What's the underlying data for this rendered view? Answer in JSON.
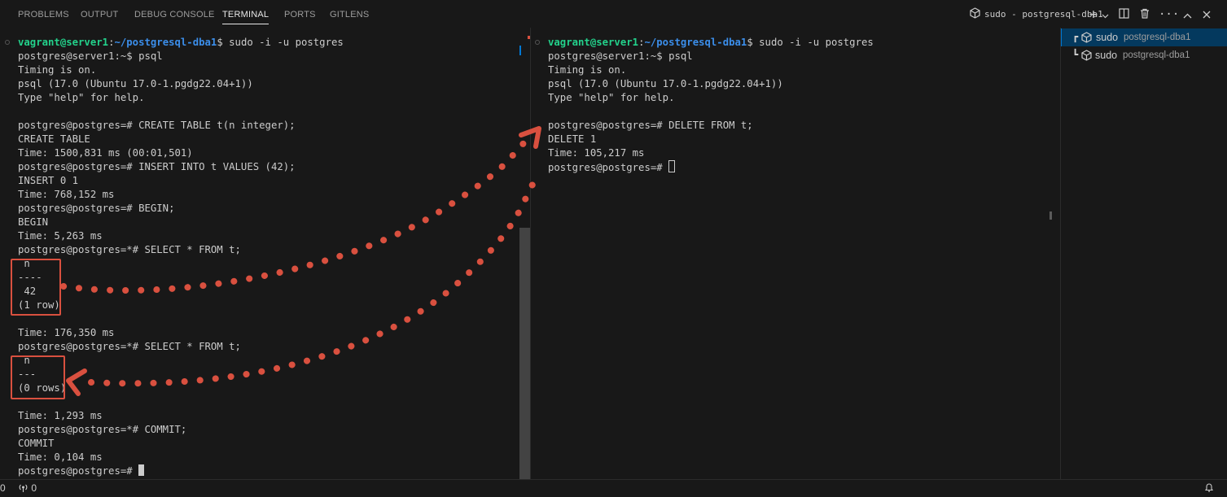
{
  "panel": {
    "tabs": [
      {
        "label": "PROBLEMS",
        "active": false
      },
      {
        "label": "OUTPUT",
        "active": false
      },
      {
        "label": "DEBUG CONSOLE",
        "active": false
      },
      {
        "label": "TERMINAL",
        "active": true
      },
      {
        "label": "PORTS",
        "active": false
      },
      {
        "label": "GITLENS",
        "active": false
      }
    ],
    "active_terminal_title": "sudo - postgresql-dba1",
    "toolbar_icons": [
      "terminal-icon",
      "add-icon",
      "chevron-down-icon",
      "split-icon",
      "trash-icon",
      "more-icon",
      "chevron-up-icon",
      "close-icon"
    ]
  },
  "left_terminal": {
    "prompt": {
      "user": "vagrant@server1",
      "path": "~/postgresql-dba1",
      "command": "$ sudo -i -u postgres"
    },
    "lines": [
      "postgres@server1:~$ psql",
      "Timing is on.",
      "psql (17.0 (Ubuntu 17.0-1.pgdg22.04+1))",
      "Type \"help\" for help.",
      "",
      "postgres@postgres=# CREATE TABLE t(n integer);",
      "CREATE TABLE",
      "Time: 1500,831 ms (00:01,501)",
      "postgres@postgres=# INSERT INTO t VALUES (42);",
      "INSERT 0 1",
      "Time: 768,152 ms",
      "postgres@postgres=# BEGIN;",
      "BEGIN",
      "Time: 5,263 ms",
      "postgres@postgres=*# SELECT * FROM t;",
      " n",
      "----",
      " 42",
      "(1 row)",
      "",
      "Time: 176,350 ms",
      "postgres@postgres=*# SELECT * FROM t;",
      " n",
      "---",
      "(0 rows)",
      "",
      "Time: 1,293 ms",
      "postgres@postgres=*# COMMIT;",
      "COMMIT",
      "Time: 0,104 ms",
      "postgres@postgres=# "
    ]
  },
  "right_terminal": {
    "prompt": {
      "user": "vagrant@server1",
      "path": "~/postgresql-dba1",
      "command": "$ sudo -i -u postgres"
    },
    "lines": [
      "postgres@server1:~$ psql",
      "Timing is on.",
      "psql (17.0 (Ubuntu 17.0-1.pgdg22.04+1))",
      "Type \"help\" for help.",
      "",
      "postgres@postgres=# DELETE FROM t;",
      "DELETE 1",
      "Time: 105,217 ms",
      "postgres@postgres=# "
    ]
  },
  "terminal_list": [
    {
      "name": "sudo",
      "description": "postgresql-dba1",
      "active": true
    },
    {
      "name": "sudo",
      "description": "postgresql-dba1",
      "active": false
    }
  ],
  "statusbar": {
    "left_number": "0",
    "ports_count": "0"
  },
  "colors": {
    "annotation": "#d9503f",
    "prompt_user": "#23d18b",
    "prompt_path": "#3b8eea",
    "active_item": "#04395e"
  }
}
